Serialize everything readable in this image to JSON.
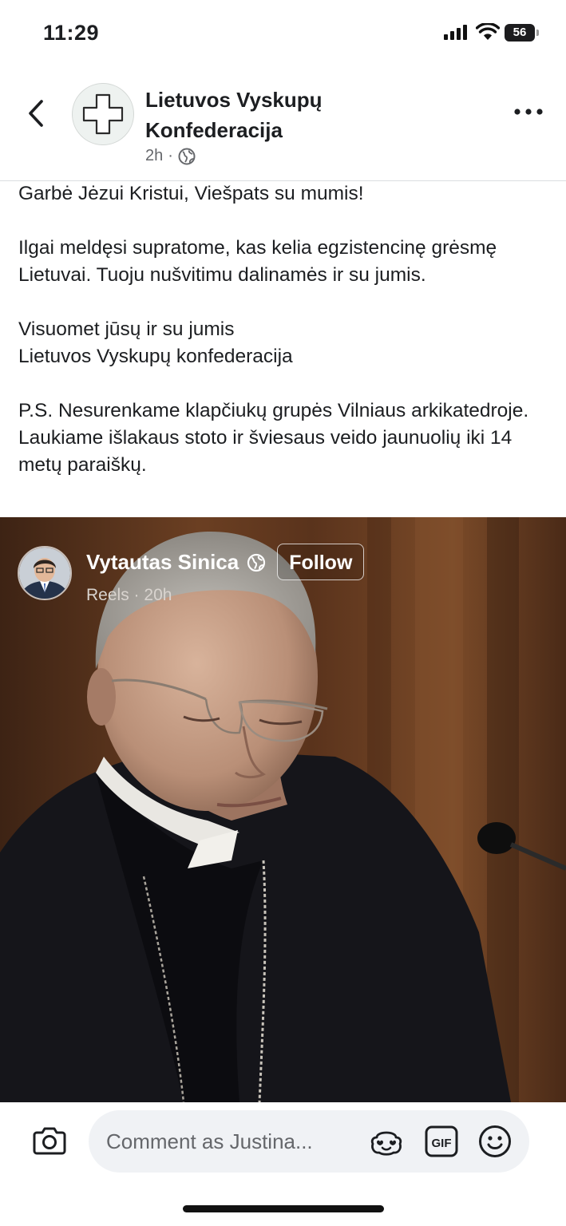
{
  "status_bar": {
    "time": "11:29",
    "battery": "56",
    "icons": [
      "signal-icon",
      "wifi-icon",
      "battery-icon"
    ]
  },
  "header": {
    "page_name": "Lietuvos Vyskupų Konfederacija",
    "time": "2h",
    "separator": "·",
    "icons": [
      "back-icon",
      "globe-icon",
      "more-icon"
    ]
  },
  "post": {
    "paragraphs": [
      "Garbė Jėzui Kristui, Viešpats su mumis!",
      "Ilgai meldęsi supratome, kas kelia egzistencinę grėsmę Lietuvai. Tuoju nušvitimu dalinamės ir su jumis.",
      "Visuomet jūsų ir su jumis\nLietuvos Vyskupų konfederacija",
      "P.S. Nesurenkame klapčiukų grupės Vilniaus arkikatedroje. Laukiame išlakaus stoto ir šviesaus veido jaunuolių iki 14 metų paraiškų."
    ]
  },
  "reel": {
    "author_name": "Vytautas Sinica",
    "follow_label": "Follow",
    "source": "Reels",
    "separator": "·",
    "time": "20h"
  },
  "comment_bar": {
    "placeholder": "Comment as Justina...",
    "icons": [
      "camera-icon",
      "avatar-sticker-icon",
      "gif-icon",
      "emoji-icon"
    ],
    "gif_label": "GIF"
  },
  "colors": {
    "text": "#1c1e21",
    "secondary_text": "#65676b",
    "comment_background": "#f0f2f5",
    "reel_background": "#4a2a18"
  }
}
